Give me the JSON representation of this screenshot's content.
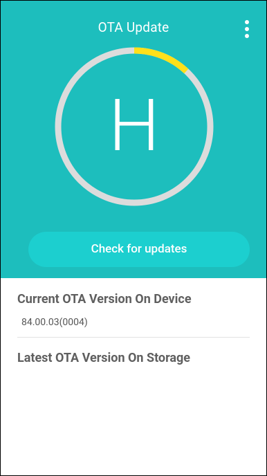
{
  "header": {
    "title": "OTA Update",
    "menu_icon": "more-vert-icon"
  },
  "dial": {
    "letter": "H",
    "progress": 0.12,
    "track_color": "#dcdcdc",
    "progress_color": "#ffe01a"
  },
  "actions": {
    "check_label": "Check for updates"
  },
  "info": {
    "current_title": "Current OTA Version On Device",
    "current_value": "84.00.03(0004)",
    "latest_title": "Latest OTA Version On Storage"
  },
  "colors": {
    "primary": "#1dbebd",
    "button": "#1ccfcf",
    "accent": "#ffe01a"
  }
}
